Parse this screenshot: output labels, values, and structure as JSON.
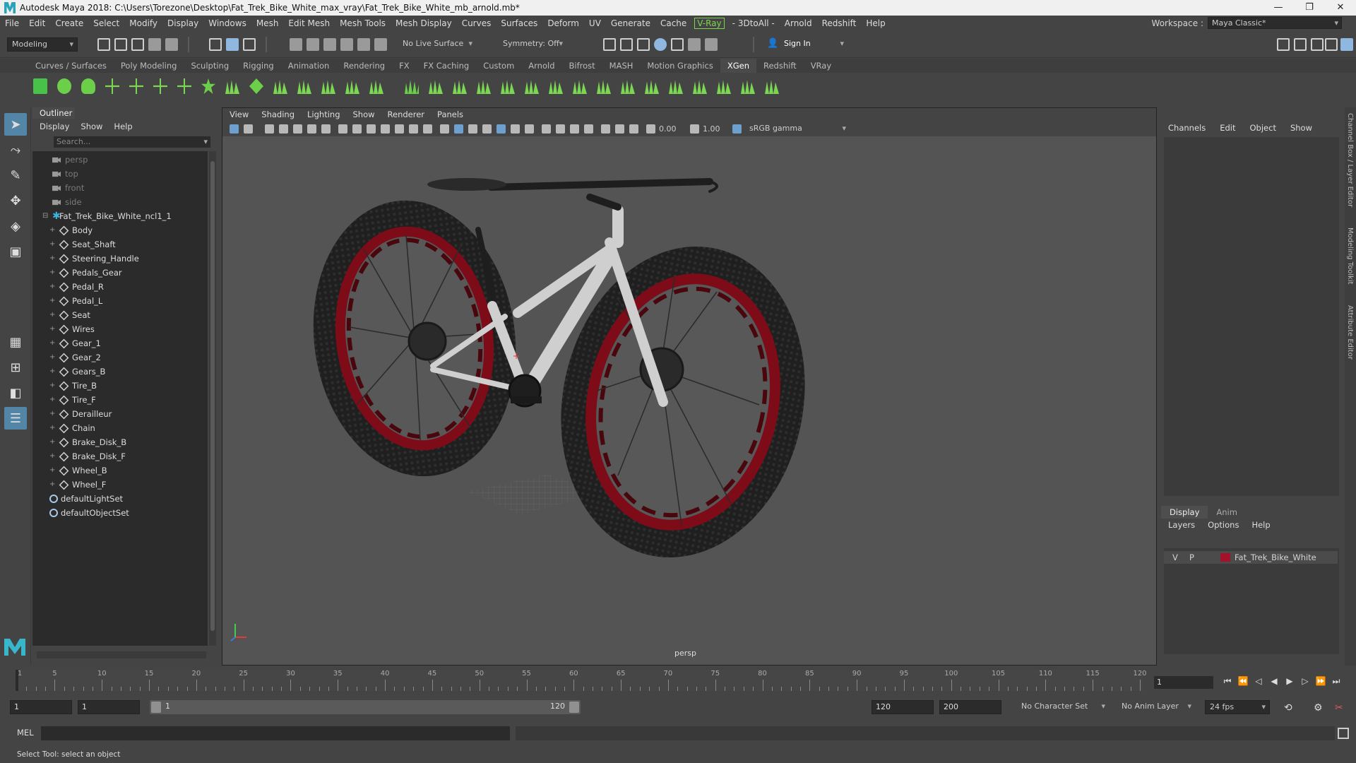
{
  "window": {
    "title": "Autodesk Maya 2018: C:\\Users\\Torezone\\Desktop\\Fat_Trek_Bike_White_max_vray\\Fat_Trek_Bike_White_mb_arnold.mb*",
    "minimize": "—",
    "maximize": "❐",
    "close": "✕"
  },
  "menubar": {
    "items": [
      "File",
      "Edit",
      "Create",
      "Select",
      "Modify",
      "Display",
      "Windows",
      "Mesh",
      "Edit Mesh",
      "Mesh Tools",
      "Mesh Display",
      "Curves",
      "Surfaces",
      "Deform",
      "UV",
      "Generate",
      "Cache"
    ],
    "vray": "V-Ray",
    "items2": [
      "- 3DtoAll -",
      "Arnold",
      "Redshift",
      "Help"
    ],
    "workspace_label": "Workspace :",
    "workspace_value": "Maya Classic*"
  },
  "statusline": {
    "mode": "Modeling",
    "live_surface": "No Live Surface",
    "symmetry": "Symmetry: Off",
    "sign_in": "Sign In"
  },
  "shelf": {
    "tabs": [
      "Curves / Surfaces",
      "Poly Modeling",
      "Sculpting",
      "Rigging",
      "Animation",
      "Rendering",
      "FX",
      "FX Caching",
      "Custom",
      "Arnold",
      "Bifrost",
      "MASH",
      "Motion Graphics",
      "XGen",
      "Redshift",
      "VRay"
    ],
    "active_tab": "XGen"
  },
  "outliner": {
    "title": "Outliner",
    "menu": [
      "Display",
      "Show",
      "Help"
    ],
    "search_placeholder": "Search...",
    "cameras": [
      "persp",
      "top",
      "front",
      "side"
    ],
    "group": "Fat_Trek_Bike_White_ncl1_1",
    "meshes": [
      "Body",
      "Seat_Shaft",
      "Steering_Handle",
      "Pedals_Gear",
      "Pedal_R",
      "Pedal_L",
      "Seat",
      "Wires",
      "Gear_1",
      "Gear_2",
      "Gears_B",
      "Tire_B",
      "Tire_F",
      "Derailleur",
      "Chain",
      "Brake_Disk_B",
      "Brake_Disk_F",
      "Wheel_B",
      "Wheel_F"
    ],
    "sets": [
      "defaultLightSet",
      "defaultObjectSet"
    ]
  },
  "viewport": {
    "menu": [
      "View",
      "Shading",
      "Lighting",
      "Show",
      "Renderer",
      "Panels"
    ],
    "exposure": "0.00",
    "gamma": "1.00",
    "color_space": "sRGB gamma",
    "camera_label": "persp"
  },
  "channelbox": {
    "menu": [
      "Channels",
      "Edit",
      "Object",
      "Show"
    ]
  },
  "layers": {
    "tabs": [
      "Display",
      "Anim"
    ],
    "active_tab": "Display",
    "menu": [
      "Layers",
      "Options",
      "Help"
    ],
    "rows": [
      {
        "v": "V",
        "p": "P",
        "name": "Fat_Trek_Bike_White",
        "color": "#a3112a"
      }
    ]
  },
  "sidetabs": [
    "Channel Box / Layer Editor",
    "Modeling Toolkit",
    "Attribute Editor"
  ],
  "timeslider": {
    "labels": [
      "5",
      "10",
      "15",
      "20",
      "25",
      "30",
      "35",
      "40",
      "45",
      "50",
      "55",
      "60",
      "65",
      "70",
      "75",
      "80",
      "85",
      "90",
      "95",
      "100",
      "105",
      "110",
      "115",
      "120"
    ],
    "first_label": "1",
    "current_frame": "1"
  },
  "rangeslider": {
    "start": "1",
    "playback_start": "1",
    "range_start": "1",
    "range_end": "120",
    "playback_end": "120",
    "end": "200",
    "character_set": "No Character Set",
    "anim_layer": "No Anim Layer",
    "fps": "24 fps"
  },
  "cmdline": {
    "label": "MEL"
  },
  "helpline": {
    "text": "Select Tool: select an object"
  },
  "colors": {
    "tire_rim": "#8b0e1c",
    "frame": "#cfcfcf",
    "accent": "#5285a6",
    "xgen_icons": "#6ccf4a"
  }
}
